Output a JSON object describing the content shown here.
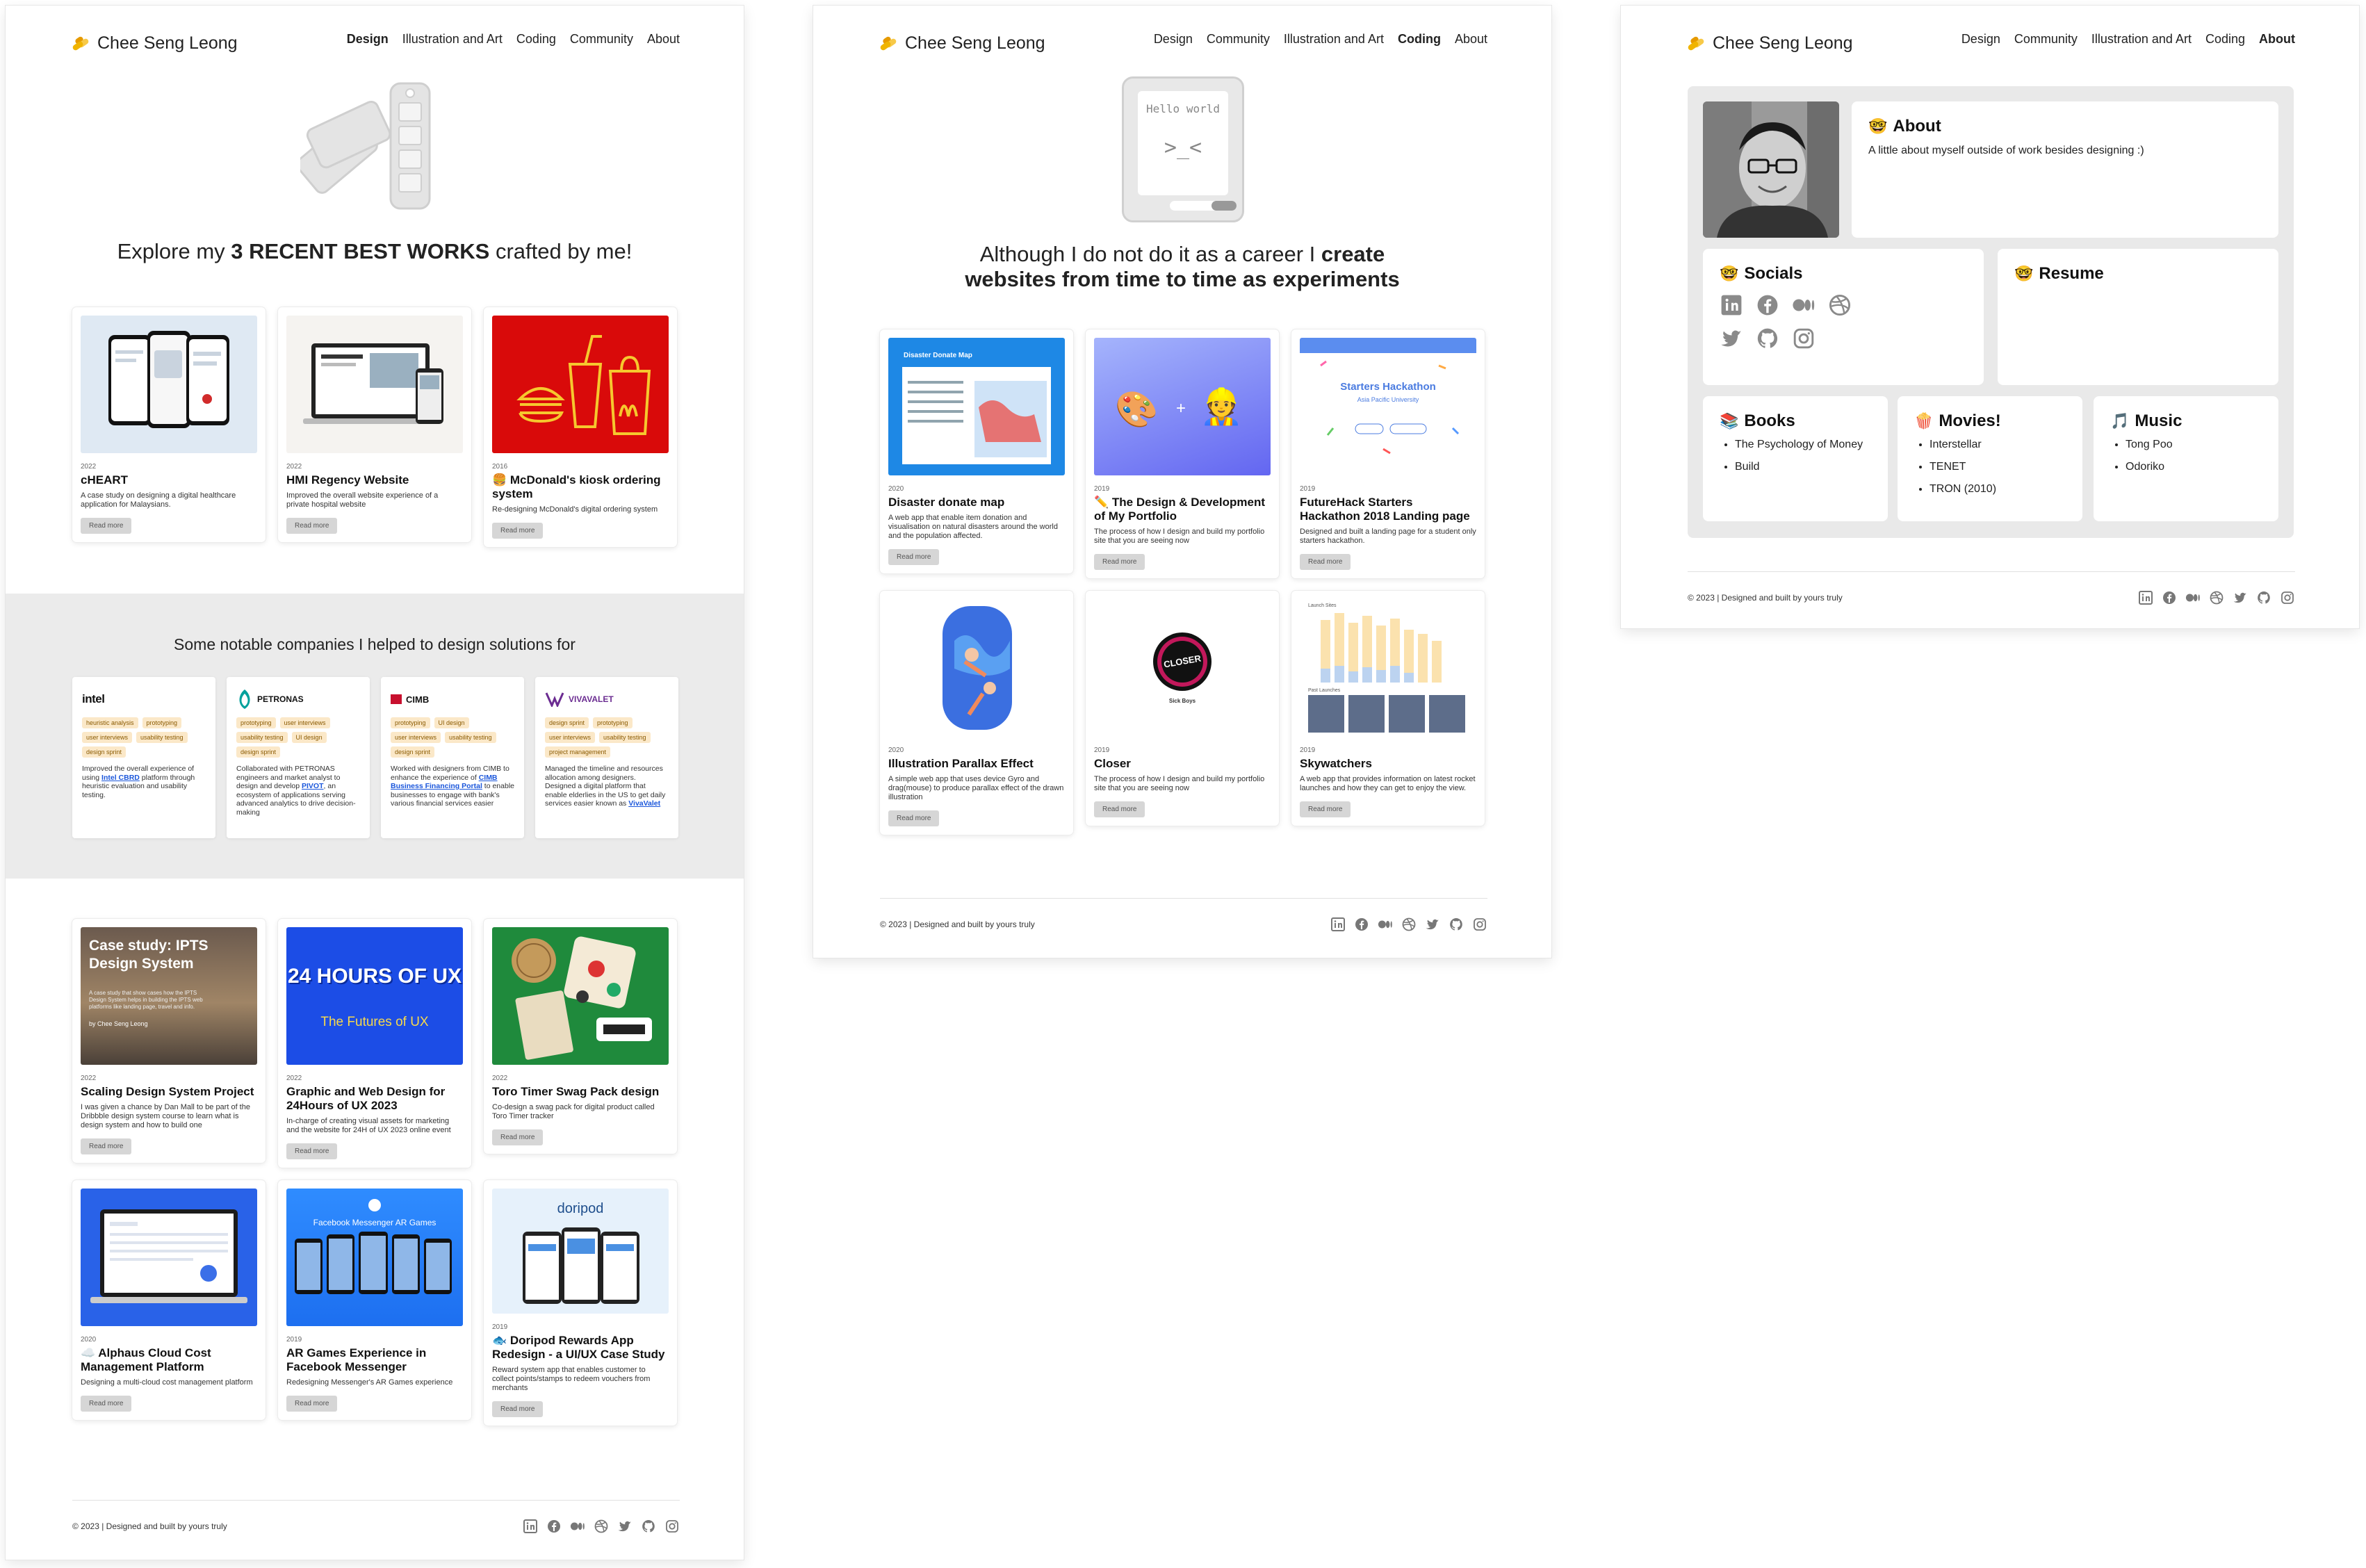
{
  "site": {
    "logo_text": "Chee Seng Leong"
  },
  "design_page": {
    "nav": [
      "Design",
      "Illustration and Art",
      "Coding",
      "Community",
      "About"
    ],
    "active": "Design",
    "hero": {
      "prefix": "Explore my ",
      "bold": "3 RECENT BEST WORKS",
      "suffix": " crafted by me!"
    },
    "recent_works": [
      {
        "year": "2022",
        "title": "cHEART",
        "desc": "A case study on designing a digital healthcare application for Malaysians.",
        "cta": "Read more"
      },
      {
        "year": "2022",
        "title": "HMI Regency Website",
        "desc": "Improved the overall website experience of a private hospital website",
        "cta": "Read more"
      },
      {
        "year": "2016",
        "title": "🍔 McDonald's kiosk ordering system",
        "desc": "Re-designing McDonald's digital ordering system",
        "cta": "Read more"
      }
    ],
    "companies_title": "Some notable companies I helped to design solutions for",
    "companies": [
      {
        "name": "intel",
        "tags": [
          "heuristic analysis",
          "prototyping",
          "user interviews",
          "usability testing",
          "design sprint"
        ],
        "desc_pre": "Improved the overall experience of using ",
        "desc_link": "Intel CBRD",
        "desc_post": " platform through heuristic evaluation and usability testing."
      },
      {
        "name": "PETRONAS",
        "tags": [
          "prototyping",
          "user interviews",
          "usability testing",
          "UI design",
          "design sprint"
        ],
        "desc_pre": "Collaborated with PETRONAS engineers and market analyst to design and develop ",
        "desc_link": "PIVOT",
        "desc_post": ", an ecosystem of applications serving advanced analytics to drive decision-making"
      },
      {
        "name": "CIMB",
        "tags": [
          "prototyping",
          "UI design",
          "user interviews",
          "usability testing",
          "design sprint"
        ],
        "desc_pre": "Worked with designers from CIMB to enhance the experience of ",
        "desc_link": "CIMB Business Financing Portal",
        "desc_post": " to enable businesses to engage with bank's various financial services easier"
      },
      {
        "name": "VIVAVALET",
        "tags": [
          "design sprint",
          "prototyping",
          "user interviews",
          "usability testing",
          "project management"
        ],
        "desc_pre": "Managed the timeline and resources allocation among designers. Designed a digital platform that enable elderlies in the US to get daily services easier known as ",
        "desc_link": "VivaValet",
        "desc_post": ""
      }
    ],
    "more_works": [
      {
        "year": "2022",
        "title": "Scaling Design System Project",
        "desc": "I was given a chance by Dan Mall to be part of the Dribbble design system course to learn what is design system and how to build one",
        "cta": "Read more",
        "thumb_title": "Case study: IPTS Design System",
        "thumb_sub": "A case study that show cases how the IPTS Design System helps in building the IPTS web platforms like landing page, travel and info.",
        "thumb_author": "by Chee Seng Leong"
      },
      {
        "year": "2022",
        "title": "Graphic and Web Design for 24Hours of UX 2023",
        "desc": "In-charge of creating visual assets for marketing and the website for 24H of UX 2023 online event",
        "cta": "Read more",
        "thumb_title": "24 HOURS OF UX",
        "thumb_sub": "The Futures of UX"
      },
      {
        "year": "2022",
        "title": "Toro Timer Swag Pack design",
        "desc": "Co-design a swag pack for digital product called Toro Timer tracker",
        "cta": "Read more"
      },
      {
        "year": "2020",
        "title": "☁️ Alphaus Cloud Cost Management Platform",
        "desc": "Designing a multi-cloud cost management platform",
        "cta": "Read more"
      },
      {
        "year": "2019",
        "title": "AR Games Experience in Facebook Messenger",
        "desc": "Redesigning Messenger's AR Games experience",
        "cta": "Read more",
        "thumb_title": "Facebook Messenger AR Games"
      },
      {
        "year": "2019",
        "title": "🐟 Doripod Rewards App Redesign - a UI/UX Case Study",
        "desc": "Reward system app that enables customer to collect points/stamps to redeem vouchers from merchants",
        "cta": "Read more",
        "thumb_title": "doripod"
      }
    ],
    "footer": "© 2023 | Designed and built by yours truly"
  },
  "coding_page": {
    "nav": [
      "Design",
      "Community",
      "Illustration and Art",
      "Coding",
      "About"
    ],
    "active": "Coding",
    "hero_icon_text": "Hello world",
    "hero_icon_face": ">_<",
    "hero": {
      "line1_pre": "Although I do not do it as a career I ",
      "line1_bold": "create",
      "line2_bold": "websites from time to time as experiments"
    },
    "works": [
      {
        "year": "2020",
        "title": "Disaster donate map",
        "desc": "A web app that enable item donation and visualisation on natural disasters around the world and the population affected.",
        "cta": "Read more",
        "thumb_title": "Disaster Donate Map"
      },
      {
        "year": "2019",
        "title": "✏️ The Design & Development of My Portfolio",
        "desc": "The process of how I design and build my portfolio site that you are seeing now",
        "cta": "Read more"
      },
      {
        "year": "2019",
        "title": "FutureHack Starters Hackathon 2018 Landing page",
        "desc": "Designed and built a landing page for a student only starters hackathon.",
        "cta": "Read more",
        "thumb_title": "Starters Hackathon",
        "thumb_sub": "Asia Pacific University"
      },
      {
        "year": "2020",
        "title": "Illustration Parallax Effect",
        "desc": "A simple web app that uses device Gyro and drag(mouse) to produce parallax effect of the drawn illustration",
        "cta": "Read more"
      },
      {
        "year": "2019",
        "title": "Closer",
        "desc": "The process of how I design and build my portfolio site that you are seeing now",
        "cta": "Read more",
        "thumb_title": "CLOSER",
        "thumb_sub": "Sick Boys"
      },
      {
        "year": "2019",
        "title": "Skywatchers",
        "desc": "A web app that provides information on latest rocket launches and how they can get to enjoy the view.",
        "cta": "Read more",
        "thumb_title": "Launch Sites",
        "thumb_sub": "Past Launches"
      }
    ],
    "footer": "© 2023 | Designed and built by yours truly"
  },
  "about_page": {
    "nav": [
      "Design",
      "Community",
      "Illustration and Art",
      "Coding",
      "About"
    ],
    "active": "About",
    "about": {
      "emoji": "🤓",
      "title": "About",
      "text": "A little about myself outside of work besides designing :)"
    },
    "socials": {
      "emoji": "🤓",
      "title": "Socials"
    },
    "resume": {
      "emoji": "🤓",
      "title": "Resume"
    },
    "books": {
      "emoji": "📚",
      "title": "Books",
      "items": [
        "The Psychology of Money",
        "Build"
      ]
    },
    "movies": {
      "emoji": "🍿",
      "title": "Movies!",
      "items": [
        "Interstellar",
        "TENET",
        "TRON (2010)"
      ]
    },
    "music": {
      "emoji": "🎵",
      "title": "Music",
      "items": [
        "Tong Poo",
        "Odoriko"
      ]
    },
    "footer": "© 2023 | Designed and built by yours truly"
  },
  "icons": [
    "linkedin-icon",
    "facebook-icon",
    "medium-icon",
    "dribbble-icon",
    "twitter-icon",
    "github-icon",
    "instagram-icon"
  ],
  "colors": {
    "band": "#ebebeb",
    "tag_bg": "#fbe8c8",
    "link": "#1a56db",
    "mcd_red": "#d90a0a",
    "ux24_blue": "#1c4de6"
  }
}
